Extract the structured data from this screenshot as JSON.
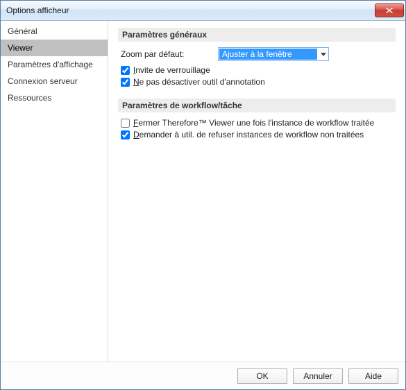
{
  "window": {
    "title": "Options afficheur"
  },
  "sidebar": {
    "items": [
      {
        "label": "Général"
      },
      {
        "label": "Viewer"
      },
      {
        "label": "Paramètres d'affichage"
      },
      {
        "label": "Connexion serveur"
      },
      {
        "label": "Ressources"
      }
    ],
    "selected_index": 1
  },
  "sections": {
    "general": {
      "header": "Paramètres généraux",
      "zoom_label": "Zoom par défaut:",
      "zoom_value": "Ajuster à la fenêtre",
      "lock_prompt": {
        "checked": true,
        "html": "<u>I</u>nvite de verrouillage"
      },
      "no_deactivate": {
        "checked": true,
        "html": "<u>N</u>e pas désactiver outil d'annotation"
      }
    },
    "workflow": {
      "header": "Paramètres de workflow/tâche",
      "close_viewer": {
        "checked": false,
        "html": "<u>F</u>ermer Therefore™ Viewer une fois l'instance de workflow traitée"
      },
      "ask_reject": {
        "checked": true,
        "html": "<u>D</u>emander à util. de refuser instances de workflow non traitées"
      }
    }
  },
  "footer": {
    "ok": "OK",
    "cancel": "Annuler",
    "help": "Aide"
  }
}
